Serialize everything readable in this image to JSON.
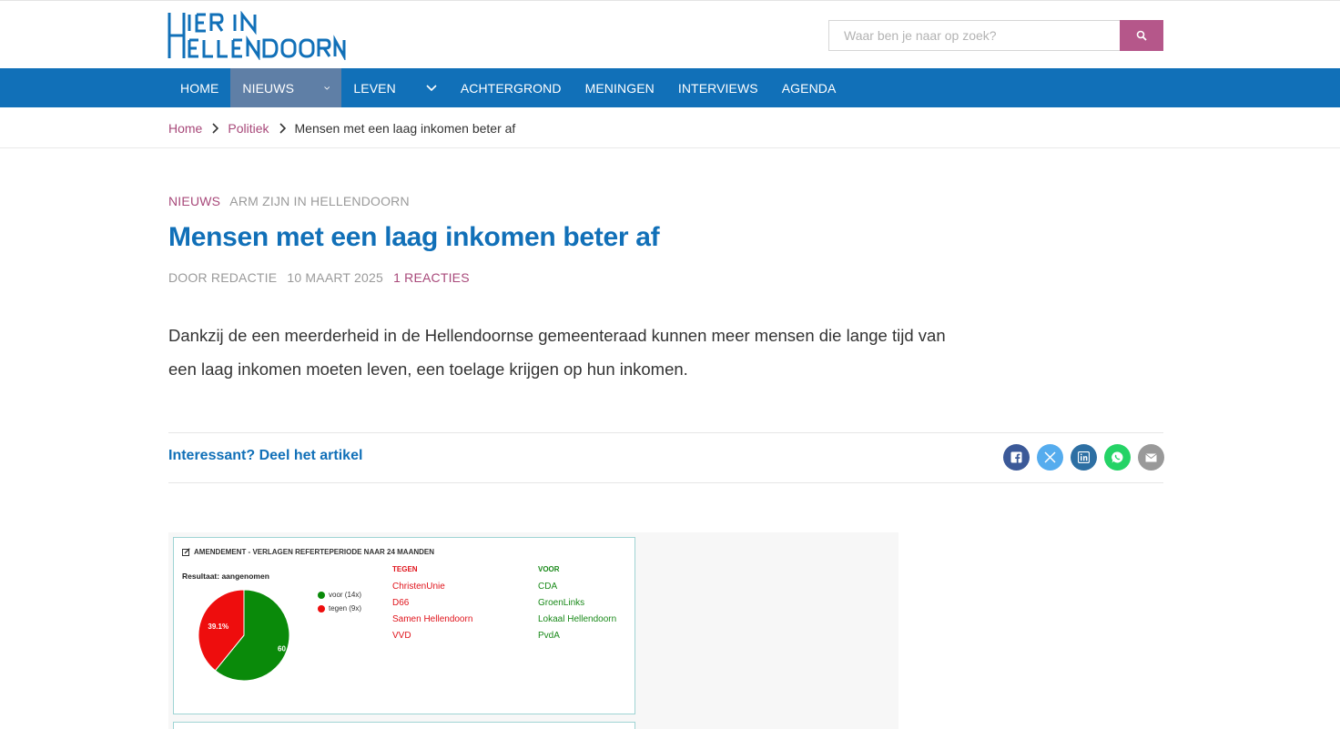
{
  "site": {
    "logo_line1": "HIER IN",
    "logo_line2": "HELLENDOORN",
    "brand_color": "#1170b8",
    "accent_color": "#a8497a"
  },
  "search": {
    "placeholder": "Waar ben je naar op zoek?",
    "button_icon": "search-icon"
  },
  "nav": {
    "items": [
      {
        "label": "HOME",
        "has_dropdown": false,
        "active": false
      },
      {
        "label": "NIEUWS",
        "has_dropdown": true,
        "active": true
      },
      {
        "label": "LEVEN",
        "has_dropdown": true,
        "active": false
      },
      {
        "label": "ACHTERGROND",
        "has_dropdown": false,
        "active": false
      },
      {
        "label": "MENINGEN",
        "has_dropdown": false,
        "active": false
      },
      {
        "label": "INTERVIEWS",
        "has_dropdown": false,
        "active": false
      },
      {
        "label": "AGENDA",
        "has_dropdown": false,
        "active": false
      }
    ]
  },
  "breadcrumb": {
    "home": "Home",
    "section": "Politiek",
    "current": "Mensen met een laag inkomen beter af"
  },
  "article": {
    "category": "NIEUWS",
    "tag": "ARM ZIJN IN HELLENDOORN",
    "title": "Mensen met een laag inkomen beter af",
    "author": "DOOR REDACTIE",
    "date": "10 MAART 2025",
    "comments": "1 REACTIES",
    "lead": "Dankzij de een meerderheid in de Hellendoornse gemeenteraad kunnen meer mensen die lange tijd van een laag inkomen moeten leven, een toelage krijgen op hun inkomen."
  },
  "share": {
    "label": "Interessant? Deel het artikel",
    "icons": [
      "facebook-icon",
      "x-icon",
      "linkedin-icon",
      "whatsapp-icon",
      "mail-icon"
    ]
  },
  "vote": {
    "heading": "AMENDEMENT - VERLAGEN REFERTEPERIODE NAAR 24 MAANDEN",
    "result": "Resultaat: aangenomen",
    "legend_voor": "voor (14x)",
    "legend_tegen": "tegen (9x)",
    "tegen_header": "TEGEN",
    "voor_header": "VOOR",
    "tegen": [
      "ChristenUnie",
      "D66",
      "Samen Hellendoorn",
      "VVD"
    ],
    "voor": [
      "CDA",
      "GroenLinks",
      "Lokaal Hellendoorn",
      "PvdA"
    ]
  },
  "chart_data": {
    "type": "pie",
    "categories": [
      "voor",
      "tegen"
    ],
    "values": [
      14,
      9
    ],
    "slice_labels": [
      "60",
      "39.1%"
    ],
    "colors": [
      "#0a8a0a",
      "#ee0d0d"
    ]
  }
}
